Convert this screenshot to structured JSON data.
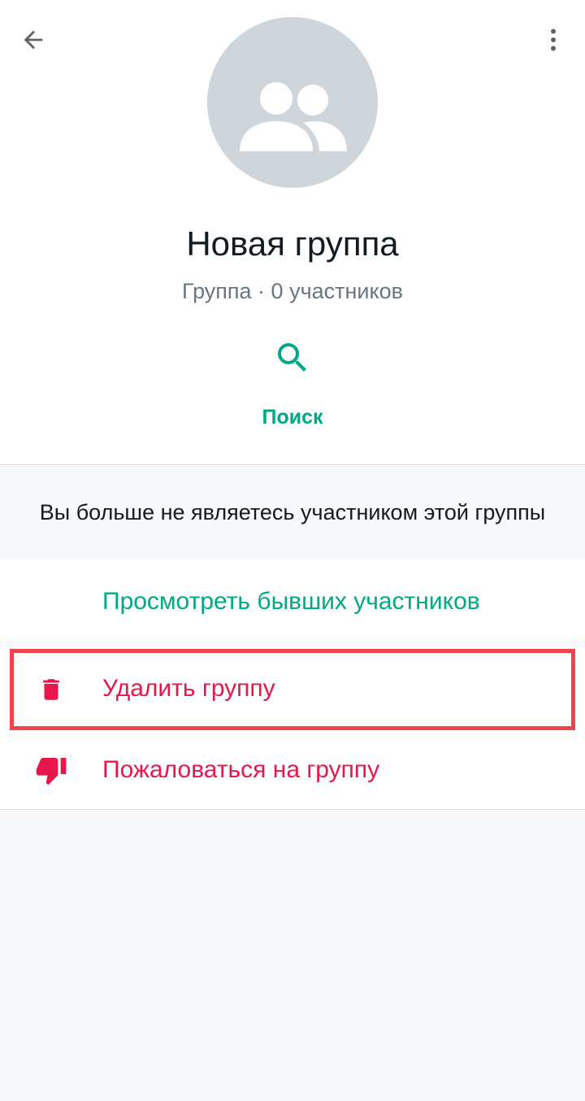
{
  "toolbar": {
    "back_icon": "arrow-left-icon",
    "menu_icon": "more-vertical-icon"
  },
  "profile": {
    "avatar_icon": "group-icon",
    "title": "Новая группа",
    "subtitle": "Группа · 0 участников"
  },
  "actions": {
    "search_icon": "search-icon",
    "search_label": "Поиск"
  },
  "notice": {
    "text": "Вы больше не являетесь участником этой группы"
  },
  "list": {
    "former_members_label": "Просмотреть бывших участников",
    "delete_group_icon": "trash-icon",
    "delete_group_label": "Удалить группу",
    "report_group_icon": "thumbs-down-icon",
    "report_group_label": "Пожаловаться на группу"
  },
  "colors": {
    "accent_green": "#00a884",
    "danger_red": "#e8174b",
    "highlight_red": "#f0454e",
    "avatar_bg": "#cfd6db",
    "background": "#f7f8fa"
  }
}
